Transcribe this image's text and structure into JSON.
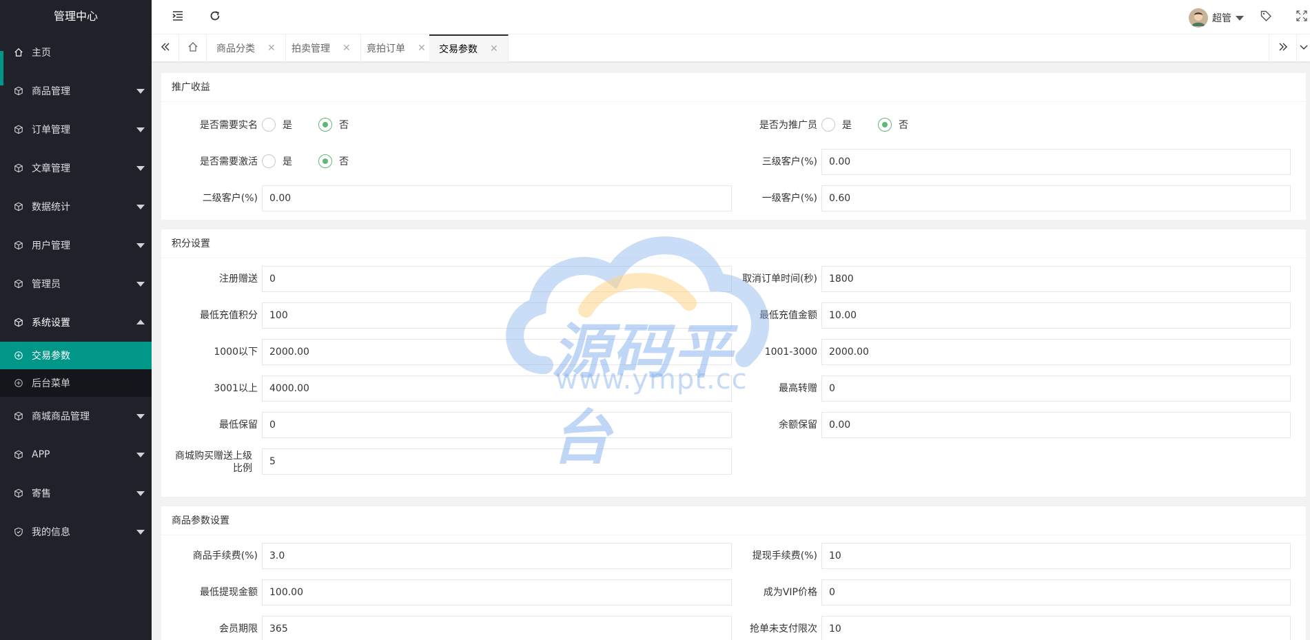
{
  "sidebar": {
    "title": "管理中心",
    "home": "主页",
    "items": [
      {
        "label": "商品管理"
      },
      {
        "label": "订单管理"
      },
      {
        "label": "文章管理"
      },
      {
        "label": "数据统计"
      },
      {
        "label": "用户管理"
      },
      {
        "label": "管理员"
      },
      {
        "label": "系统设置",
        "open": true
      }
    ],
    "subitems": [
      {
        "label": "交易参数",
        "active": true
      },
      {
        "label": "后台菜单"
      }
    ],
    "items_after": [
      {
        "label": "商城商品管理"
      },
      {
        "label": "APP"
      },
      {
        "label": "寄售"
      },
      {
        "label": "我的信息"
      }
    ]
  },
  "header": {
    "user_name": "超管"
  },
  "tabs": [
    {
      "label": "商品分类"
    },
    {
      "label": "拍卖管理"
    },
    {
      "label": "竟拍订单"
    },
    {
      "label": "交易参数",
      "active": true
    }
  ],
  "sections": {
    "promo": {
      "title": "推广收益",
      "need_realname_label": "是否需要实名",
      "need_activate_label": "是否需要激活",
      "is_promoter_label": "是否为推广员",
      "yes": "是",
      "no": "否",
      "level3_label": "三级客户(%)",
      "level3_value": "0.00",
      "level2_label": "二级客户(%)",
      "level2_value": "0.00",
      "level1_label": "一级客户(%)",
      "level1_value": "0.60"
    },
    "points": {
      "title": "积分设置",
      "register_gift_label": "注册赠送",
      "register_gift_value": "0",
      "cancel_order_time_label": "取消订单时间(秒)",
      "cancel_order_time_value": "1800",
      "min_recharge_points_label": "最低充值积分",
      "min_recharge_points_value": "100",
      "min_recharge_amount_label": "最低充值金额",
      "min_recharge_amount_value": "10.00",
      "below_1000_label": "1000以下",
      "below_1000_value": "2000.00",
      "range_1001_3000_label": "1001-3000",
      "range_1001_3000_value": "2000.00",
      "above_3001_label": "3001以上",
      "above_3001_value": "4000.00",
      "max_transfer_label": "最高转赠",
      "max_transfer_value": "0",
      "min_keep_label": "最低保留",
      "min_keep_value": "0",
      "balance_keep_label": "余额保留",
      "balance_keep_value": "0.00",
      "mall_gift_label": "商城购买赠送上级比例",
      "mall_gift_value": "5"
    },
    "goods": {
      "title": "商品参数设置",
      "goods_fee_label": "商品手续费(%)",
      "goods_fee_value": "3.0",
      "withdraw_fee_label": "提现手续费(%)",
      "withdraw_fee_value": "10",
      "min_withdraw_label": "最低提现金额",
      "min_withdraw_value": "100.00",
      "vip_price_label": "成为VIP价格",
      "vip_price_value": "0",
      "member_term_label": "会员期限",
      "member_term_value": "365",
      "unpaid_limit_label": "抢单未支付限次",
      "unpaid_limit_value": "10"
    }
  },
  "watermark": {
    "text": "源码平台",
    "url": "www.ympt.cc"
  },
  "colors": {
    "sidebar_bg": "#20222a",
    "accent": "#009688",
    "radio_on": "#5fb878"
  }
}
